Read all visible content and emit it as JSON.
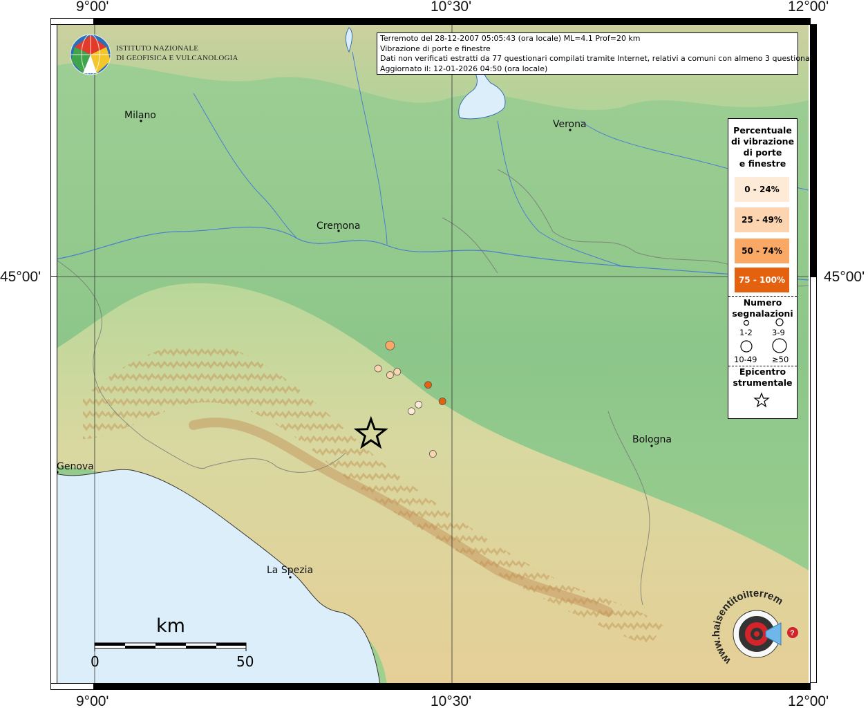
{
  "coords": {
    "top_left": "9°00'",
    "top_mid": "10°30'",
    "top_right": "12°00'",
    "bottom_left": "9°00'",
    "bottom_mid": "10°30'",
    "bottom_right": "12°00'",
    "left_lat": "45°00'",
    "right_lat": "45°00'"
  },
  "info": {
    "line1": "Terremoto del 28-12-2007 05:05:43 (ora locale) ML=4.1 Prof=20 km",
    "line2": "Vibrazione di porte e finestre",
    "line3": "Dati non verificati estratti da 77 questionari compilati tramite Internet, relativi a comuni con almeno 3 questionari.",
    "line4": "Aggiornato il: 12-01-2026 04:50 (ora locale)"
  },
  "logo": {
    "line1": "ISTITUTO NAZIONALE",
    "line2": "DI GEOFISICA E VULCANOLOGIA"
  },
  "cities": [
    {
      "name": "Milano"
    },
    {
      "name": "Verona"
    },
    {
      "name": "Cremona"
    },
    {
      "name": "Bologna"
    },
    {
      "name": "Genova"
    },
    {
      "name": "La Spezia"
    }
  ],
  "legend": {
    "title1": "Percentuale",
    "title2": "di vibrazione",
    "title3": "di porte",
    "title4": "e finestre",
    "classes": [
      {
        "label": "0 - 24%",
        "color": "#fdebd7"
      },
      {
        "label": "25 - 49%",
        "color": "#fcd4b0"
      },
      {
        "label": "50 - 74%",
        "color": "#f9a865"
      },
      {
        "label": "75 - 100%",
        "color": "#e4620f"
      }
    ],
    "count_title1": "Numero",
    "count_title2": "segnalazioni",
    "sizes": [
      "1-2",
      "3-9",
      "10-49",
      "≥50"
    ],
    "epi1": "Epicentro",
    "epi2": "strumentale"
  },
  "scale": {
    "unit": "km",
    "start": "0",
    "end": "50"
  },
  "observations": [
    {
      "lon": 10.24,
      "lat": 44.79,
      "pct_class": 2,
      "count": "3-9"
    },
    {
      "lon": 10.27,
      "lat": 44.71,
      "pct_class": 1,
      "count": "1-2"
    },
    {
      "lon": 10.19,
      "lat": 44.72,
      "pct_class": 1,
      "count": "1-2"
    },
    {
      "lon": 10.24,
      "lat": 44.7,
      "pct_class": 1,
      "count": "1-2"
    },
    {
      "lon": 10.4,
      "lat": 44.67,
      "pct_class": 3,
      "count": "1-2"
    },
    {
      "lon": 10.46,
      "lat": 44.62,
      "pct_class": 3,
      "count": "1-2"
    },
    {
      "lon": 10.36,
      "lat": 44.61,
      "pct_class": 0,
      "count": "1-2"
    },
    {
      "lon": 10.33,
      "lat": 44.59,
      "pct_class": 0,
      "count": "1-2"
    },
    {
      "lon": 10.42,
      "lat": 44.46,
      "pct_class": 1,
      "count": "1-2"
    }
  ],
  "epicenter": {
    "lon": 10.16,
    "lat": 44.52
  },
  "watermark": "www.haisentitoilterremoto.it"
}
